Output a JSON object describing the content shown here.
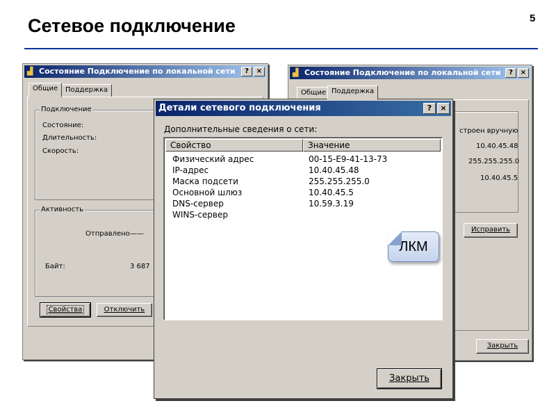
{
  "slide": {
    "title": "Сетевое подключение",
    "number": "5"
  },
  "window_general": {
    "title": "Состояние Подключение по локальной сети",
    "help_btn": "?",
    "close_btn": "×",
    "tabs": [
      "Общие",
      "Поддержка"
    ],
    "connection_group": "Подключение",
    "status_label": "Состояние:",
    "duration_label": "Длительность:",
    "speed_label": "Скорость:",
    "activity_group": "Активность",
    "sent_label": "Отправлено",
    "sent_dash": "——",
    "bytes_label": "Байт:",
    "bytes_value": "3 687",
    "properties_btn": "Свойства",
    "disable_btn": "Отключить"
  },
  "window_support": {
    "title": "Состояние Подключение по локальной сети",
    "help_btn": "?",
    "close_btn": "×",
    "tabs": [
      "Общие",
      "Поддержка"
    ],
    "assigned_text": "строен вручную",
    "ip_value": "10.40.45.48",
    "mask_value": "255.255.255.0",
    "gateway_value": "10.40.45.5",
    "repair_btn": "Исправить",
    "close_btn_label": "Закрыть"
  },
  "details_dialog": {
    "title": "Детали сетевого подключения",
    "help_btn": "?",
    "close_btn": "×",
    "heading": "Дополнительные сведения о сети:",
    "col_property": "Свойство",
    "col_value": "Значение",
    "rows": [
      {
        "property": "Физический адрес",
        "value": "00-15-E9-41-13-73"
      },
      {
        "property": "IP-адрес",
        "value": "10.40.45.48"
      },
      {
        "property": "Маска подсети",
        "value": "255.255.255.0"
      },
      {
        "property": "Основной шлюз",
        "value": "10.40.45.5"
      },
      {
        "property": "DNS-сервер",
        "value": "10.59.3.19"
      },
      {
        "property": "WINS-сервер",
        "value": ""
      }
    ],
    "close_label": "Закрыть"
  },
  "callout": {
    "text": "ЛКМ"
  }
}
